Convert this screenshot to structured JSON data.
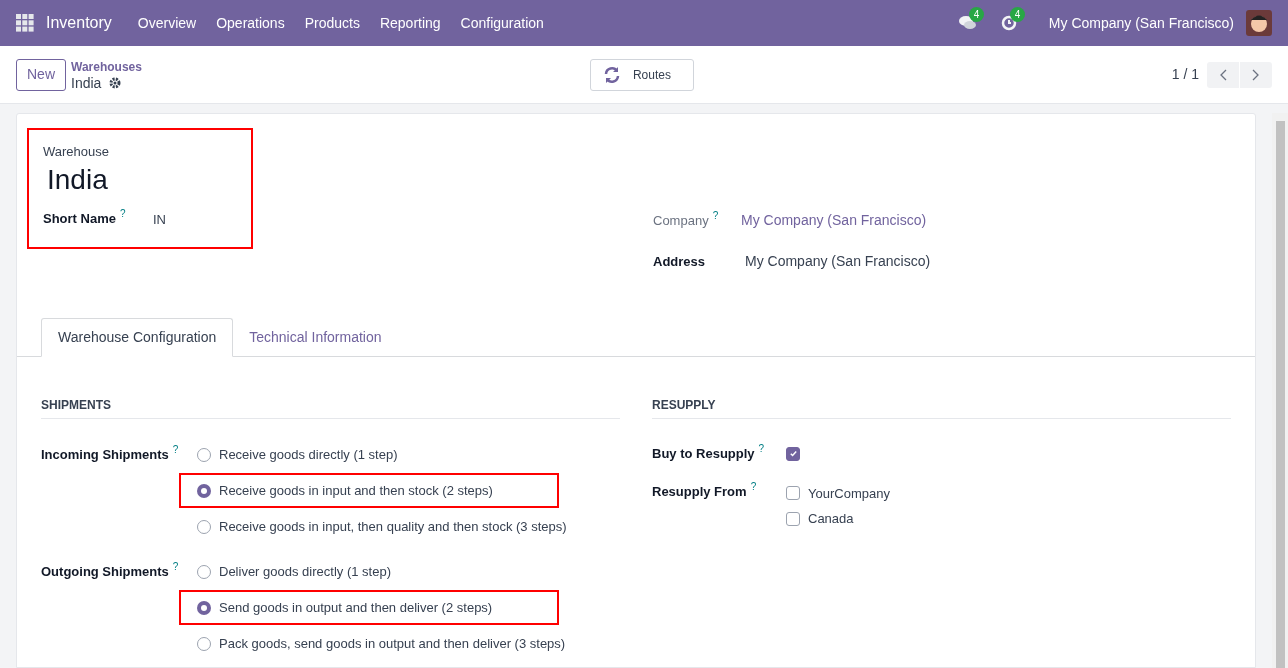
{
  "navbar": {
    "app": "Inventory",
    "menu": [
      "Overview",
      "Operations",
      "Products",
      "Reporting",
      "Configuration"
    ],
    "messages_badge": "4",
    "activities_badge": "4",
    "company": "My Company (San Francisco)"
  },
  "control_panel": {
    "new_button": "New",
    "breadcrumb": "Warehouses",
    "record": "India",
    "routes_button": "Routes",
    "pager": "1 / 1"
  },
  "header": {
    "highlighted": true,
    "label": "Warehouse",
    "name": "India",
    "short_name_label": "Short Name",
    "short_name_help": "?",
    "short_name": "IN"
  },
  "company": {
    "label": "Company",
    "help": "?",
    "value": "My Company (San Francisco)"
  },
  "address": {
    "label": "Address",
    "value": "My Company (San Francisco)"
  },
  "tabs": [
    {
      "label": "Warehouse Configuration",
      "selected": true
    },
    {
      "label": "Technical Information",
      "selected": false
    }
  ],
  "shipments": {
    "title": "SHIPMENTS",
    "groups": [
      {
        "label": "Incoming Shipments",
        "help": "?",
        "options": [
          {
            "label": "Receive goods directly (1 step)",
            "selected": false,
            "highlighted": false
          },
          {
            "label": "Receive goods in input and then stock (2 steps)",
            "selected": true,
            "highlighted": true
          },
          {
            "label": "Receive goods in input, then quality and then stock (3 steps)",
            "selected": false,
            "highlighted": false
          }
        ]
      },
      {
        "label": "Outgoing Shipments",
        "help": "?",
        "options": [
          {
            "label": "Deliver goods directly (1 step)",
            "selected": false,
            "highlighted": false
          },
          {
            "label": "Send goods in output and then deliver (2 steps)",
            "selected": true,
            "highlighted": true
          },
          {
            "label": "Pack goods, send goods in output and then deliver (3 steps)",
            "selected": false,
            "highlighted": false
          }
        ]
      }
    ]
  },
  "resupply": {
    "title": "RESUPPLY",
    "buy_label": "Buy to Resupply",
    "buy_help": "?",
    "buy_checked": true,
    "from_label": "Resupply From",
    "from_help": "?",
    "from_options": [
      {
        "label": "YourCompany",
        "checked": false
      },
      {
        "label": "Canada",
        "checked": false
      }
    ]
  }
}
